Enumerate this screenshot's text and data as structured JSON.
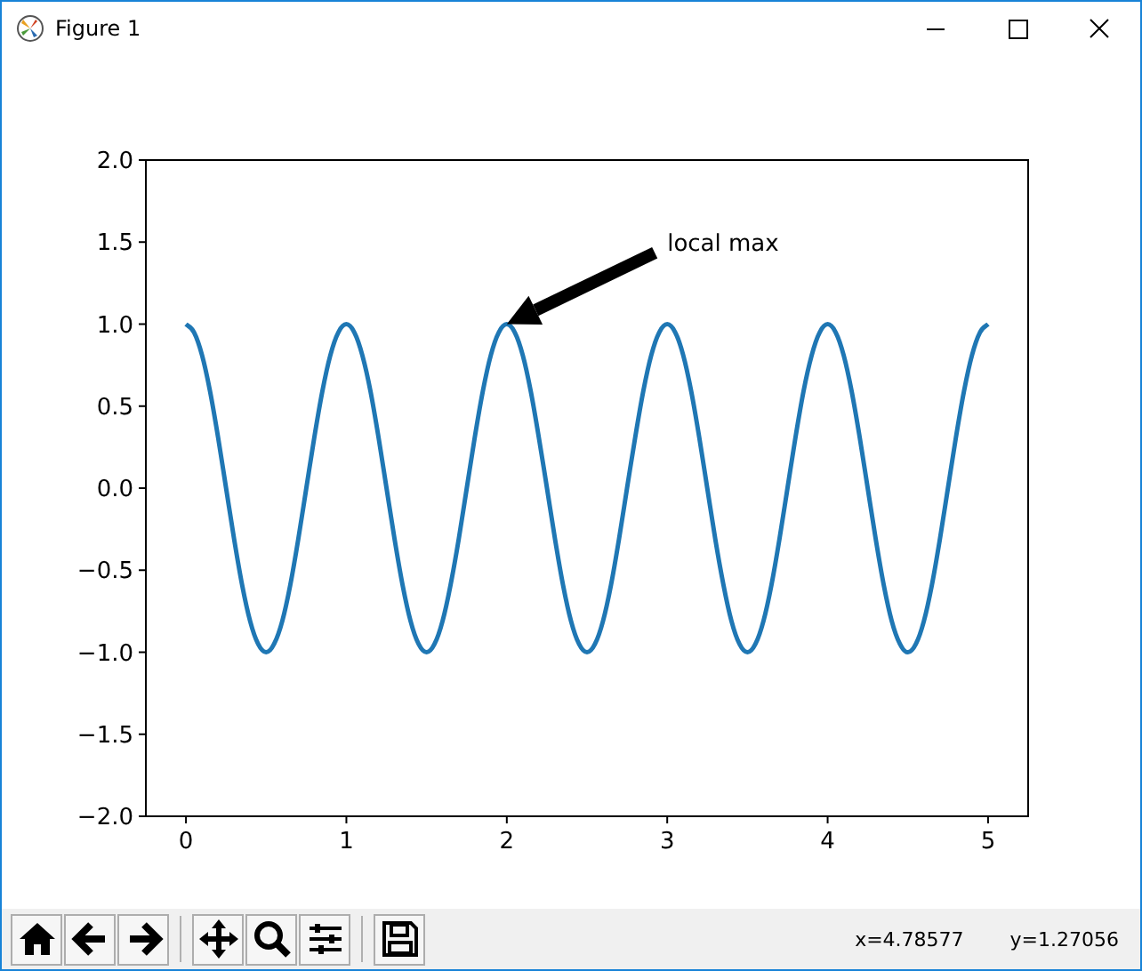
{
  "window": {
    "title": "Figure 1"
  },
  "figure": {
    "chart_data": {
      "type": "line",
      "x": [
        0,
        0.05,
        0.1,
        0.15,
        0.2,
        0.25,
        0.3,
        0.35,
        0.4,
        0.45,
        0.5,
        0.55,
        0.6,
        0.65,
        0.7,
        0.75,
        0.8,
        0.85,
        0.9,
        0.95,
        1,
        1.05,
        1.1,
        1.15,
        1.2,
        1.25,
        1.3,
        1.35,
        1.4,
        1.45,
        1.5,
        1.55,
        1.6,
        1.65,
        1.7,
        1.75,
        1.8,
        1.85,
        1.9,
        1.95,
        2,
        2.05,
        2.1,
        2.15,
        2.2,
        2.25,
        2.3,
        2.35,
        2.4,
        2.45,
        2.5,
        2.55,
        2.6,
        2.65,
        2.7,
        2.75,
        2.8,
        2.85,
        2.9,
        2.95,
        3,
        3.05,
        3.1,
        3.15,
        3.2,
        3.25,
        3.3,
        3.35,
        3.4,
        3.45,
        3.5,
        3.55,
        3.6,
        3.65,
        3.7,
        3.75,
        3.8,
        3.85,
        3.9,
        3.95,
        4,
        4.05,
        4.1,
        4.15,
        4.2,
        4.25,
        4.3,
        4.35,
        4.4,
        4.45,
        4.5,
        4.55,
        4.6,
        4.65,
        4.7,
        4.75,
        4.8,
        4.85,
        4.9,
        4.95,
        5
      ],
      "series": [
        {
          "color": "#1f77b4",
          "values": [
            1,
            0.95,
            0.81,
            0.59,
            0.31,
            0,
            -0.31,
            -0.59,
            -0.81,
            -0.95,
            -1,
            -0.95,
            -0.81,
            -0.59,
            -0.31,
            0,
            0.31,
            0.59,
            0.81,
            0.95,
            1,
            0.95,
            0.81,
            0.59,
            0.31,
            0,
            -0.31,
            -0.59,
            -0.81,
            -0.95,
            -1,
            -0.95,
            -0.81,
            -0.59,
            -0.31,
            0,
            0.31,
            0.59,
            0.81,
            0.95,
            1,
            0.95,
            0.81,
            0.59,
            0.31,
            0,
            -0.31,
            -0.59,
            -0.81,
            -0.95,
            -1,
            -0.95,
            -0.81,
            -0.59,
            -0.31,
            0,
            0.31,
            0.59,
            0.81,
            0.95,
            1,
            0.95,
            0.81,
            0.59,
            0.31,
            0,
            -0.31,
            -0.59,
            -0.81,
            -0.95,
            -1,
            -0.95,
            -0.81,
            -0.59,
            -0.31,
            0,
            0.31,
            0.59,
            0.81,
            0.95,
            1,
            0.95,
            0.81,
            0.59,
            0.31,
            0,
            -0.31,
            -0.59,
            -0.81,
            -0.95,
            -1,
            -0.95,
            -0.81,
            -0.59,
            -0.31,
            0,
            0.31,
            0.59,
            0.81,
            0.95,
            1
          ]
        }
      ],
      "xlim": [
        -0.25,
        5.25
      ],
      "ylim": [
        -2,
        2
      ],
      "xticks": [
        0,
        1,
        2,
        3,
        4,
        5
      ],
      "yticks": [
        {
          "value": -2,
          "label": "−2.0"
        },
        {
          "value": -1.5,
          "label": "−1.5"
        },
        {
          "value": -1,
          "label": "−1.0"
        },
        {
          "value": -0.5,
          "label": "−0.5"
        },
        {
          "value": 0,
          "label": "0.0"
        },
        {
          "value": 0.5,
          "label": "0.5"
        },
        {
          "value": 1,
          "label": "1.0"
        },
        {
          "value": 1.5,
          "label": "1.5"
        },
        {
          "value": 2,
          "label": "2.0"
        }
      ],
      "annotations": [
        "local max"
      ]
    }
  },
  "toolbar": {
    "status": [
      "x=4.78577",
      "y=1.27056"
    ]
  }
}
